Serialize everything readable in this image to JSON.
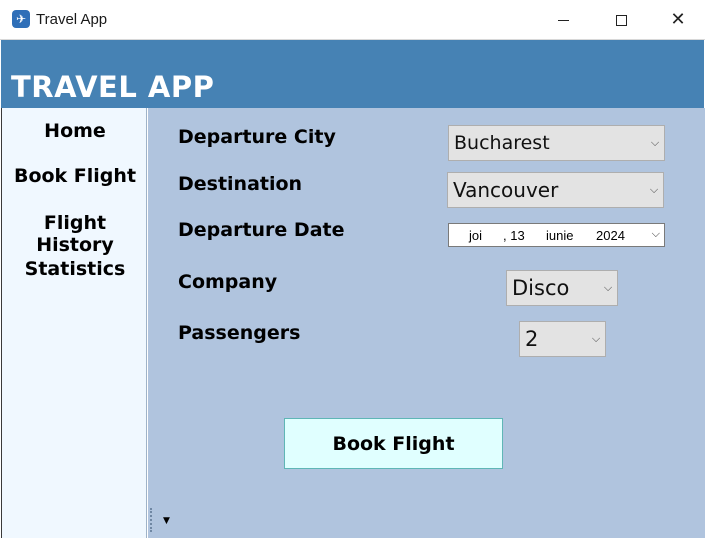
{
  "window": {
    "title": "Travel App",
    "icon": "airplane-app-icon",
    "controls": {
      "minimize": "minimize-icon",
      "maximize": "maximize-icon",
      "close": "close-icon"
    }
  },
  "header": {
    "title": "TRAVEL APP",
    "color": "#4682b4"
  },
  "sidebar": {
    "items": [
      {
        "label": "Home"
      },
      {
        "label": "Book Flight"
      },
      {
        "label": "Flight History"
      },
      {
        "label": "Statistics"
      }
    ]
  },
  "form": {
    "departure_city": {
      "label": "Departure City",
      "value": "Bucharest"
    },
    "destination": {
      "label": "Destination",
      "value": "Vancouver"
    },
    "departure_date": {
      "label": "Departure Date",
      "weekday": "joi",
      "day": ", 13",
      "month": "iunie",
      "year": "2024"
    },
    "company": {
      "label": "Company",
      "value": "Disco"
    },
    "passengers": {
      "label": "Passengers",
      "value": "2"
    }
  },
  "actions": {
    "book_label": "Book Flight"
  },
  "colors": {
    "sidebar_bg": "#f0f8ff",
    "main_bg": "#b0c4de",
    "button_bg": "#e0ffff"
  }
}
